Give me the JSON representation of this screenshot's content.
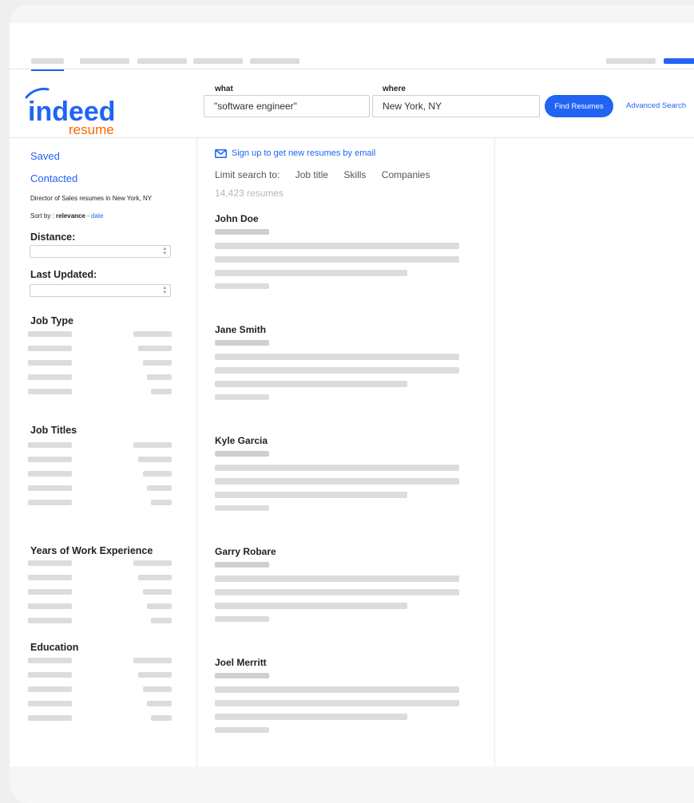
{
  "header": {
    "logo": {
      "wordmark": "indeed",
      "sub": "resume"
    },
    "what_label": "what",
    "what_value": "\"software engineer\"",
    "where_label": "where",
    "where_value": "New York, NY",
    "find_button": "Find Resumes",
    "advanced_link": "Advanced Search"
  },
  "sidebar": {
    "saved": "Saved",
    "contacted": "Contacted",
    "breadcrumb": "Director of Sales resumes in New York, NY",
    "sort_prefix": "Sort by : ",
    "sort_active": "relevance",
    "sort_sep": " - ",
    "sort_other": "date",
    "distance_label": "Distance:",
    "last_updated_label": "Last Updated:",
    "sections": [
      "Job Type",
      "Job Titles",
      "Years of Work Experience",
      "Education"
    ]
  },
  "results": {
    "signup": "Sign up to get new resumes by email",
    "limit_label": "Limit search to:",
    "limit_options": [
      "Job title",
      "Skills",
      "Companies"
    ],
    "count": "14,423 resumes",
    "names": [
      "John Doe",
      "Jane Smith",
      "Kyle Garcia",
      "Garry Robare",
      "Joel Merritt"
    ]
  },
  "colors": {
    "accent": "#2164f3",
    "logo_orange": "#ff6600",
    "placeholder_bar": "#dcdcdc"
  }
}
